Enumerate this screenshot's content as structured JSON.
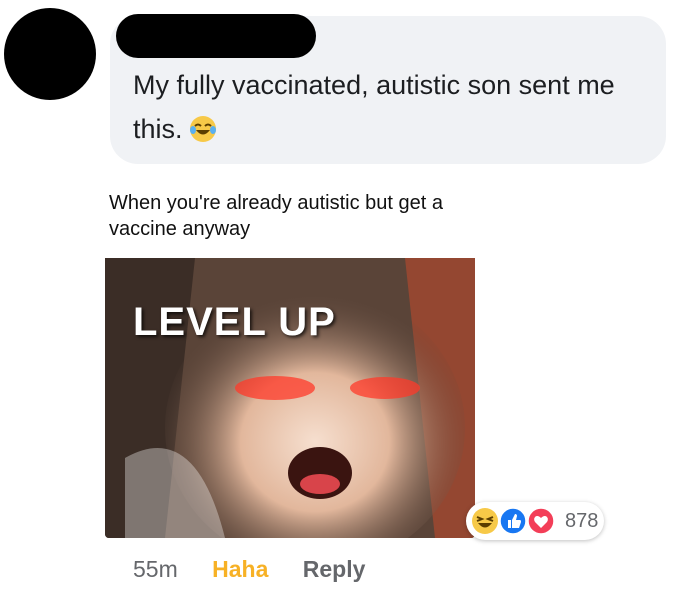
{
  "comment": {
    "text": "My fully vaccinated, autistic son sent me this.",
    "emoji_icon": "laughing-tears-emoji"
  },
  "meme": {
    "caption": "When you're already autistic but get a vaccine anyway",
    "overlay_text": "LEVEL UP",
    "photo_description_icon": "crying-child-photo"
  },
  "reactions": {
    "icons": [
      "haha-icon",
      "like-icon",
      "love-icon"
    ],
    "count": "878"
  },
  "footer": {
    "time": "55m",
    "haha": "Haha",
    "reply": "Reply"
  },
  "colors": {
    "haha": "#f7b125",
    "like": "#1877f2",
    "love": "#f33e58",
    "bubble": "#f0f2f5"
  }
}
